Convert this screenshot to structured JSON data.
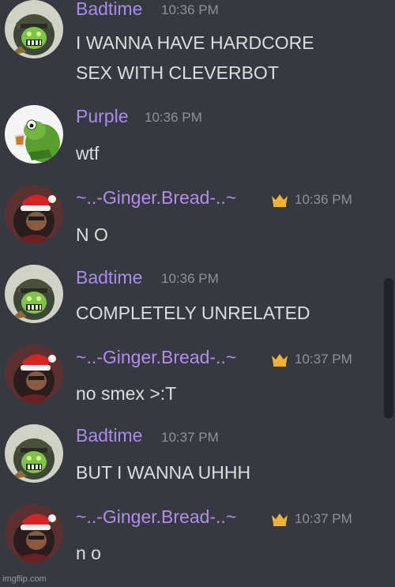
{
  "colors": {
    "background": "#36393f",
    "badtime": "#a88bef",
    "purple": "#a88bef",
    "ginger": "#b28cf0",
    "crown": "#f0b232",
    "timestamp": "#8e9297",
    "text": "#dcddde"
  },
  "messages": [
    {
      "author": "Badtime",
      "avatar": "zombie-soldier-avatar",
      "crown": false,
      "time": "10:36 PM",
      "text": "I WANNA HAVE HARDCORE\nSEX WITH CLEVERBOT"
    },
    {
      "author": "Purple",
      "avatar": "kermit-tea-avatar",
      "crown": false,
      "time": "10:36 PM",
      "text": "wtf"
    },
    {
      "author": "~..-Ginger.Bread-..~",
      "avatar": "santa-hat-avatar",
      "crown": true,
      "time": "10:36 PM",
      "text": "N O"
    },
    {
      "author": "Badtime",
      "avatar": "zombie-soldier-avatar",
      "crown": false,
      "time": "10:36 PM",
      "text": "COMPLETELY UNRELATED"
    },
    {
      "author": "~..-Ginger.Bread-..~",
      "avatar": "santa-hat-avatar",
      "crown": true,
      "time": "10:37 PM",
      "text": "no smex >:T"
    },
    {
      "author": "Badtime",
      "avatar": "zombie-soldier-avatar",
      "crown": false,
      "time": "10:37 PM",
      "text": "BUT I WANNA UHHH"
    },
    {
      "author": "~..-Ginger.Bread-..~",
      "avatar": "santa-hat-avatar",
      "crown": true,
      "time": "10:37 PM",
      "text": "n o"
    }
  ],
  "watermark": "imgflip.com"
}
